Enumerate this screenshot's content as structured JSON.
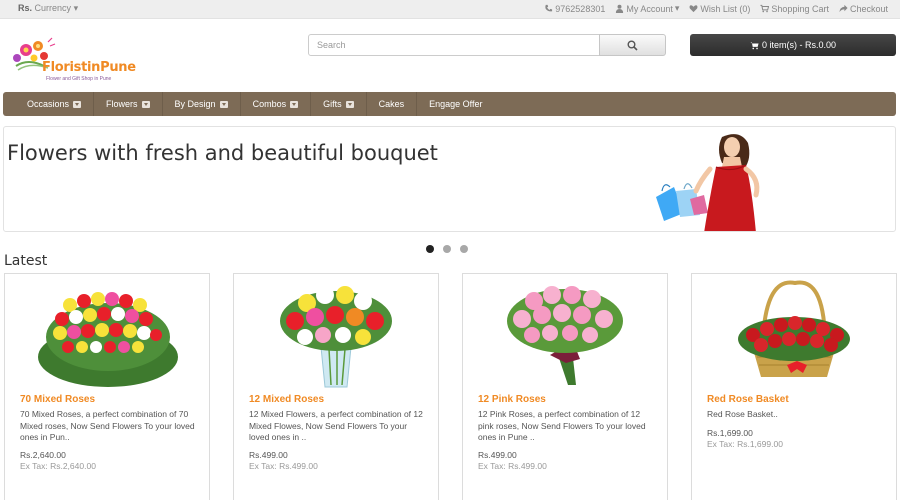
{
  "topbar": {
    "currency_symbol": "Rs.",
    "currency_label": "Currency",
    "phone": "9762528301",
    "my_account": "My Account",
    "wish_list": "Wish List (0)",
    "shopping_cart": "Shopping Cart",
    "checkout": "Checkout"
  },
  "header": {
    "logo_text": "FloristinPune",
    "logo_tagline": "Flower and Gift Shop in Pune",
    "search_placeholder": "Search",
    "cart_label": "0 item(s) - Rs.0.00"
  },
  "nav": {
    "items": [
      {
        "label": "Occasions",
        "has_dropdown": true
      },
      {
        "label": "Flowers",
        "has_dropdown": true
      },
      {
        "label": "By Design",
        "has_dropdown": true
      },
      {
        "label": "Combos",
        "has_dropdown": true
      },
      {
        "label": "Gifts",
        "has_dropdown": true
      },
      {
        "label": "Cakes",
        "has_dropdown": false
      },
      {
        "label": "Engage Offer",
        "has_dropdown": false
      }
    ]
  },
  "banner": {
    "title": "Flowers with fresh and beautiful bouquet",
    "slides": 3,
    "active_slide": 1
  },
  "latest": {
    "heading": "Latest",
    "products": [
      {
        "name": "70 Mixed Roses",
        "description": "70 Mixed Roses, a perfect combination of 70 Mixed roses, Now Send Flowers To your loved ones in Pun..",
        "price": "Rs.2,640.00",
        "ex_tax": "Ex Tax: Rs.2,640.00",
        "image_icon": "mixed-roses-bouquet-image"
      },
      {
        "name": "12 Mixed Roses",
        "description": "12 Mixed Flowers, a perfect combination of 12 Mixed Flowes, Now Send Flowers To your loved ones in ..",
        "price": "Rs.499.00",
        "ex_tax": "Ex Tax: Rs.499.00",
        "image_icon": "roses-vase-image"
      },
      {
        "name": "12 Pink Roses",
        "description": "12 Pink Roses, a perfect combination of 12 pink roses, Now Send Flowers To your loved ones in Pune ..",
        "price": "Rs.499.00",
        "ex_tax": "Ex Tax: Rs.499.00",
        "image_icon": "pink-roses-bouquet-image"
      },
      {
        "name": "Red Rose Basket",
        "description": "Red Rose Basket..",
        "price": "Rs.1,699.00",
        "ex_tax": "Ex Tax: Rs.1,699.00",
        "image_icon": "red-rose-basket-image"
      }
    ]
  },
  "colors": {
    "accent_orange": "#f08a24",
    "nav_brown": "#7d6b56",
    "cart_dark": "#333333",
    "topbar_bg": "#eeeeee"
  }
}
